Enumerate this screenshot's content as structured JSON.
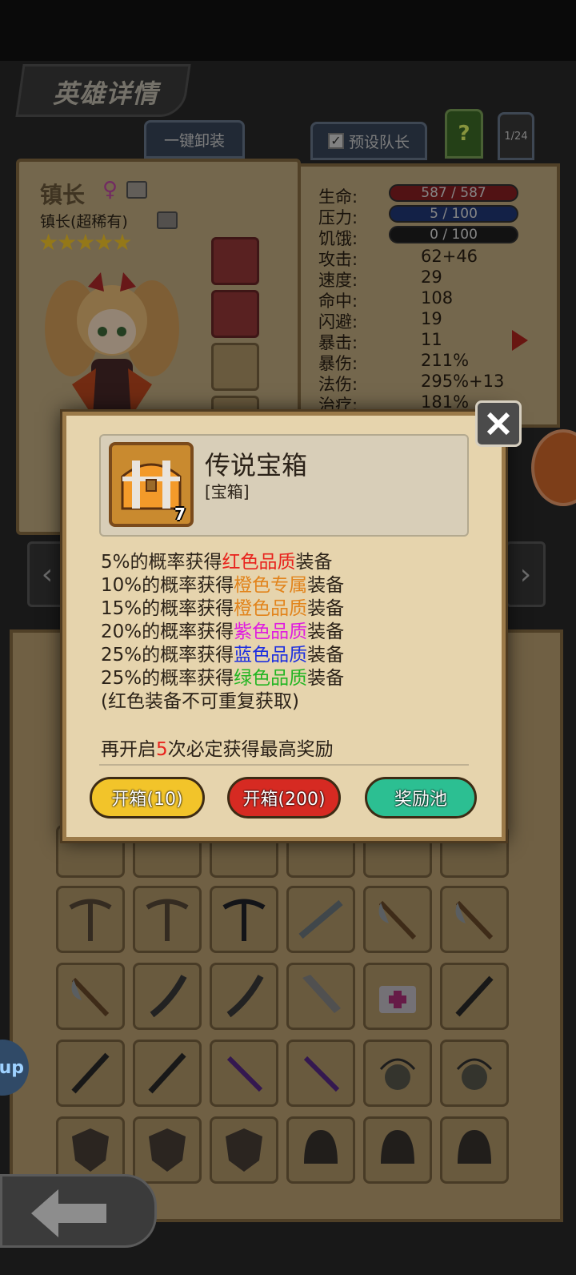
{
  "header": {
    "title": "英雄详情"
  },
  "tabs": {
    "unequip_all": "一键卸装",
    "preset_leader": "预设队长",
    "help": "?",
    "page": "1/24"
  },
  "hero": {
    "name": "镇长",
    "subtitle": "镇长(超稀有)",
    "stars": "★★★★★"
  },
  "stats": [
    {
      "label": "生命:",
      "value": "587 / 587",
      "bar_color": "#8c1f24"
    },
    {
      "label": "压力:",
      "value": "5 / 100",
      "bar_color": "#213a7a"
    },
    {
      "label": "饥饿:",
      "value": "0 / 100",
      "bar_color": "#1f1f1f"
    },
    {
      "label": "攻击:",
      "value": "62+46"
    },
    {
      "label": "速度:",
      "value": "29"
    },
    {
      "label": "命中:",
      "value": "108"
    },
    {
      "label": "闪避:",
      "value": "19"
    },
    {
      "label": "暴击:",
      "value": "11"
    },
    {
      "label": "暴伤:",
      "value": "211%"
    },
    {
      "label": "法伤:",
      "value": "295%+13"
    },
    {
      "label": "治疗:",
      "value": "181%"
    }
  ],
  "modal": {
    "item_name": "传说宝箱",
    "item_type": "[宝箱]",
    "item_count": "7",
    "lines": [
      {
        "prefix": "5%的概率获得",
        "quality": "红色品质",
        "suffix": "装备",
        "color": "#e8221c"
      },
      {
        "prefix": "10%的概率获得",
        "quality": "橙色专属",
        "suffix": "装备",
        "color": "#e2841c"
      },
      {
        "prefix": "15%的概率获得",
        "quality": "橙色品质",
        "suffix": "装备",
        "color": "#e2841c"
      },
      {
        "prefix": "20%的概率获得",
        "quality": "紫色品质",
        "suffix": "装备",
        "color": "#e01ce0"
      },
      {
        "prefix": "25%的概率获得",
        "quality": "蓝色品质",
        "suffix": "装备",
        "color": "#1c2ee0"
      },
      {
        "prefix": "25%的概率获得",
        "quality": "绿色品质",
        "suffix": "装备",
        "color": "#22b522"
      }
    ],
    "note": "(红色装备不可重复获取)",
    "guarantee_prefix": "再开启",
    "guarantee_count": "5",
    "guarantee_suffix": "次必定获得最高奖励",
    "buttons": {
      "open10": "开箱(10)",
      "open200": "开箱(200)",
      "reward_pool": "奖励池"
    }
  },
  "side": {
    "bubble": "up"
  },
  "colors": {
    "gold_btn": "#f2c42a",
    "red_btn": "#d62a22",
    "teal_btn": "#2cbf92"
  }
}
